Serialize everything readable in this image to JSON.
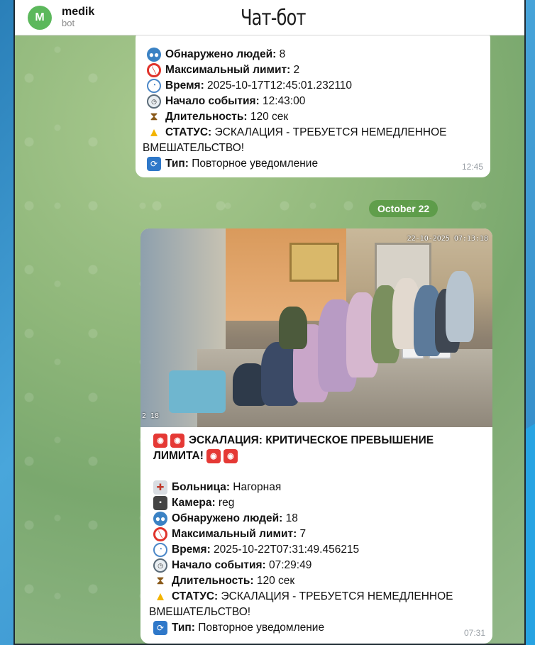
{
  "header": {
    "avatar_letter": "M",
    "bot_name": "medik",
    "bot_subtitle": "bot",
    "title": "Чат-бот"
  },
  "message1": {
    "partial_line_cut": "",
    "lines": [
      {
        "icon": "people-icon",
        "label": "Обнаружено людей:",
        "value": " 8"
      },
      {
        "icon": "no-entry-icon",
        "label": "Максимальный лимит:",
        "value": " 2"
      },
      {
        "icon": "clock-icon",
        "label": "Время:",
        "value": " 2025-10-17T12:45:01.232110"
      },
      {
        "icon": "stopwatch-icon",
        "label": "Начало события:",
        "value": " 12:43:00"
      },
      {
        "icon": "hourglass-icon",
        "label": "Длительность:",
        "value": " 120 сек"
      },
      {
        "icon": "warning-icon",
        "label": "СТАТУС:",
        "value": " ЭСКАЛАЦИЯ - ТРЕБУЕТСЯ НЕМЕДЛЕННОЕ"
      },
      {
        "icon": "",
        "label": "",
        "value": "ВМЕШАТЕЛЬСТВО!"
      },
      {
        "icon": "repeat-icon",
        "label": "Тип:",
        "value": " Повторное уведомление"
      }
    ],
    "time": "12:45"
  },
  "date_separator": "October 22",
  "message2": {
    "photo": {
      "camera_timestamp": "22-10-2025 07:13:18",
      "corner_mark": "2 18"
    },
    "headline_line1": "ЭСКАЛАЦИЯ: КРИТИЧЕСКОЕ ПРЕВЫШЕНИЕ",
    "headline_line2": "ЛИМИТА!",
    "lines": [
      {
        "icon": "hospital-icon",
        "label": "Больница:",
        "value": " Нагорная"
      },
      {
        "icon": "camera-icon",
        "label": "Камера:",
        "value": " reg"
      },
      {
        "icon": "people-icon",
        "label": "Обнаружено людей:",
        "value": " 18"
      },
      {
        "icon": "no-entry-icon",
        "label": "Максимальный лимит:",
        "value": " 7"
      },
      {
        "icon": "clock-icon",
        "label": "Время:",
        "value": " 2025-10-22T07:31:49.456215"
      },
      {
        "icon": "stopwatch-icon",
        "label": "Начало события:",
        "value": " 07:29:49"
      },
      {
        "icon": "hourglass-icon",
        "label": "Длительность:",
        "value": " 120 сек"
      },
      {
        "icon": "warning-icon",
        "label": "СТАТУС:",
        "value": " ЭСКАЛАЦИЯ - ТРЕБУЕТСЯ НЕМЕДЛЕННОЕ"
      },
      {
        "icon": "",
        "label": "",
        "value": "ВМЕШАТЕЛЬСТВО!"
      },
      {
        "icon": "repeat-icon",
        "label": "Тип:",
        "value": " Повторное уведомление"
      }
    ],
    "time": "07:31"
  },
  "colors": {
    "accent_green": "#5cb85c",
    "date_pill": "#5a9a3c",
    "alert_red": "#e53935",
    "warning_yellow": "#f3b400"
  }
}
